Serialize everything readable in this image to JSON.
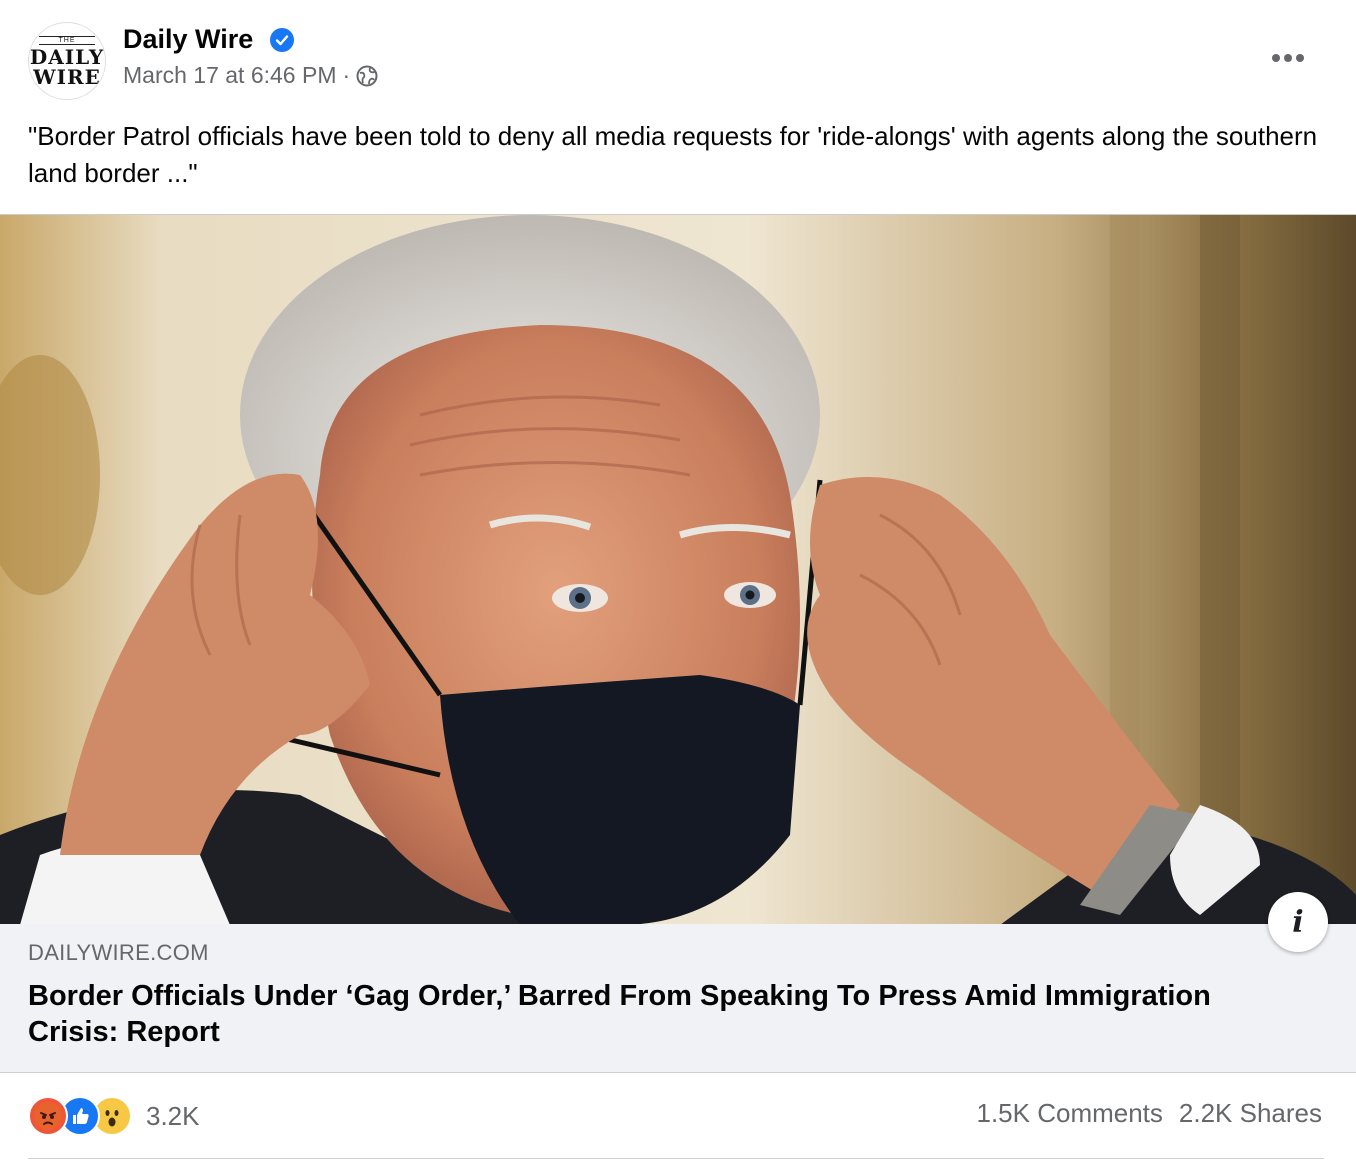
{
  "header": {
    "avatar_top": "THE",
    "avatar_line1": "DAILY",
    "avatar_line2": "WIRE",
    "page_name": "Daily Wire",
    "timestamp": "March 17 at 6:46 PM",
    "separator": "·",
    "icons": {
      "verified": "verified-badge-icon",
      "privacy": "globe-icon",
      "more": "more-options-icon"
    }
  },
  "post": {
    "text": "\"Border Patrol officials have been told to deny all media requests for 'ride-alongs' with agents along the southern land border ...\""
  },
  "link": {
    "domain": "DAILYWIRE.COM",
    "headline": "Border Officials Under ‘Gag Order,’ Barred From Speaking To Press Amid Immigration Crisis: Report",
    "info_label": "i"
  },
  "footer": {
    "reactions": [
      "angry",
      "like",
      "wow"
    ],
    "reaction_count": "3.2K",
    "comments": "1.5K Comments",
    "shares": "2.2K Shares"
  },
  "colors": {
    "accent": "#1877f2",
    "secondary_text": "#65676b",
    "link_bg": "#f0f2f5"
  }
}
